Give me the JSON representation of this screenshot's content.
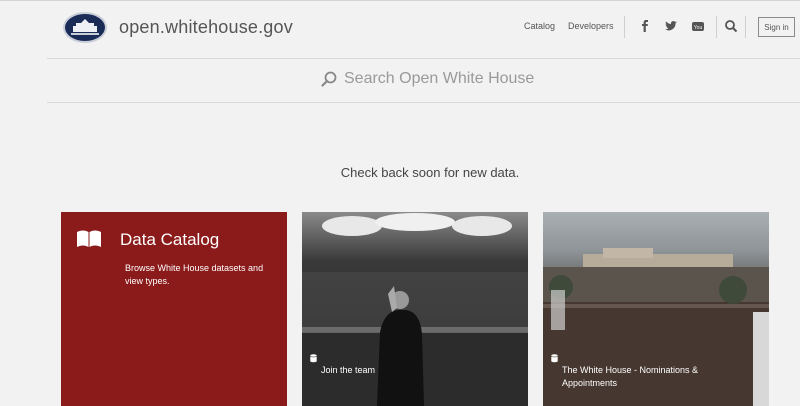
{
  "header": {
    "site_title": "open.whitehouse.gov",
    "nav": [
      "Catalog",
      "Developers"
    ],
    "social_icons": [
      "facebook-icon",
      "twitter-icon",
      "youtube-icon"
    ],
    "sign_in_label": "Sign in"
  },
  "search": {
    "placeholder": "Search Open White House"
  },
  "notice": "Check back soon for new data.",
  "cards": [
    {
      "title": "Data Catalog",
      "description": "Browse White House datasets and view types."
    },
    {
      "label": "Join the team"
    },
    {
      "label": "The White House - Nominations & Appointments"
    }
  ],
  "colors": {
    "catalog_card": "#8b1a1a",
    "background": "#f2f2f2"
  }
}
